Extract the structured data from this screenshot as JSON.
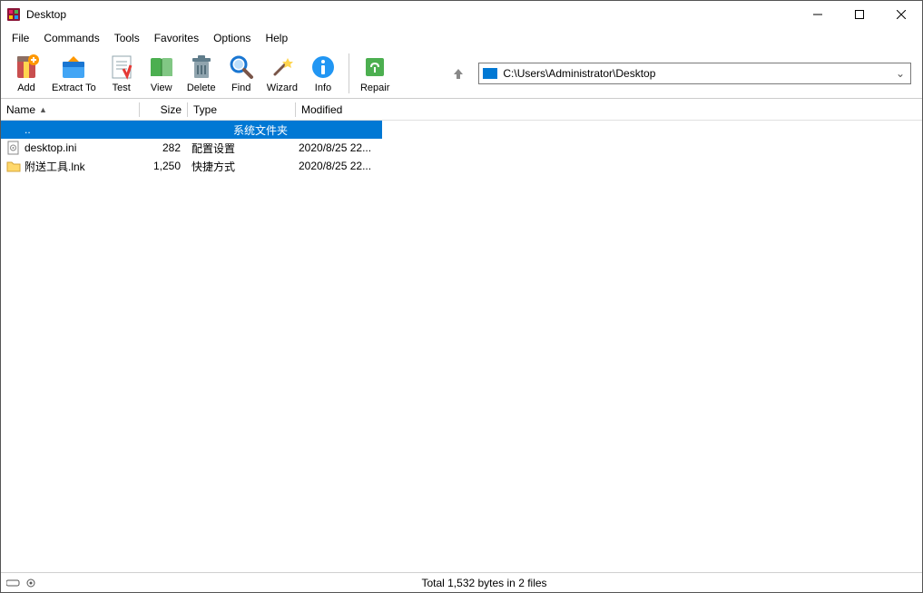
{
  "window": {
    "title": "Desktop"
  },
  "menu": {
    "items": [
      "File",
      "Commands",
      "Tools",
      "Favorites",
      "Options",
      "Help"
    ]
  },
  "toolbar": {
    "add": "Add",
    "extract": "Extract To",
    "test": "Test",
    "view": "View",
    "delete": "Delete",
    "find": "Find",
    "wizard": "Wizard",
    "info": "Info",
    "repair": "Repair"
  },
  "path": "C:\\Users\\Administrator\\Desktop",
  "columns": {
    "name": "Name",
    "size": "Size",
    "type": "Type",
    "modified": "Modified"
  },
  "rows": [
    {
      "name": "..",
      "size": "",
      "type": "系统文件夹",
      "modified": "",
      "selected": true,
      "icon": "up"
    },
    {
      "name": "desktop.ini",
      "size": "282",
      "type": "配置设置",
      "modified": "2020/8/25 22...",
      "icon": "ini"
    },
    {
      "name": "附送工具.lnk",
      "size": "1,250",
      "type": "快捷方式",
      "modified": "2020/8/25 22...",
      "icon": "folder"
    }
  ],
  "status": "Total 1,532 bytes in 2 files"
}
